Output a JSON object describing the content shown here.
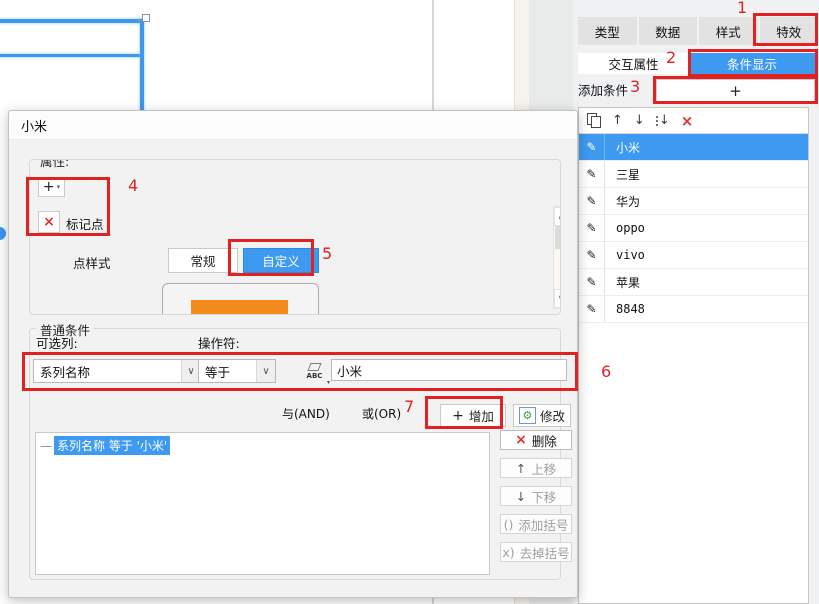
{
  "annotations": {
    "n1": "1",
    "n2": "2",
    "n3": "3",
    "n4": "4",
    "n5": "5",
    "n6": "6",
    "n7": "7"
  },
  "right_panel": {
    "tabs": [
      {
        "label": "类型"
      },
      {
        "label": "数据"
      },
      {
        "label": "样式"
      },
      {
        "label": "特效"
      }
    ],
    "interactive_props_label": "交互属性",
    "condition_display_label": "条件显示",
    "add_condition_label": "添加条件",
    "add_condition_button": "+",
    "series_list": [
      {
        "label": "小米"
      },
      {
        "label": "三星"
      },
      {
        "label": "华为"
      },
      {
        "label": "oppo"
      },
      {
        "label": "vivo"
      },
      {
        "label": "苹果"
      },
      {
        "label": "8848"
      }
    ]
  },
  "dialog": {
    "title": "小米",
    "attributes": {
      "legend": "属性:",
      "mark_point_label": "标记点",
      "point_style_label": "点样式",
      "normal_button": "常规",
      "custom_button": "自定义"
    },
    "conditions": {
      "legend": "普通条件",
      "column_label": "可选列:",
      "operator_label": "操作符:",
      "column_value": "系列名称",
      "operator_value": "等于",
      "value_input": "小米",
      "and_option": "与(AND)",
      "or_option": "或(OR)",
      "add_button": "增加",
      "modify_button": "修改",
      "delete_button": "删除",
      "move_up_button": "上移",
      "move_down_button": "下移",
      "add_bracket_button": "添加括号",
      "remove_bracket_button": "去掉括号",
      "condition_item": "系列名称 等于 '小米'"
    }
  },
  "icons": {
    "pencil": "✎",
    "up_arrow": "↑",
    "down_arrow": "↓",
    "delete_x": "×",
    "mark_x": "×",
    "plus": "+",
    "chevron": "∨",
    "scroll_up": "∧",
    "scroll_down": "∨",
    "dropdown": "▾",
    "gear": "⚙",
    "abc": "ABC",
    "brackets": "()",
    "remove_brackets": "x)",
    "dash": "—"
  },
  "colors": {
    "accent_blue": "#3d9af0",
    "annotation_red": "#e02222",
    "orange_preview": "#f28a1e",
    "selection_blue": "#3d97ef"
  }
}
